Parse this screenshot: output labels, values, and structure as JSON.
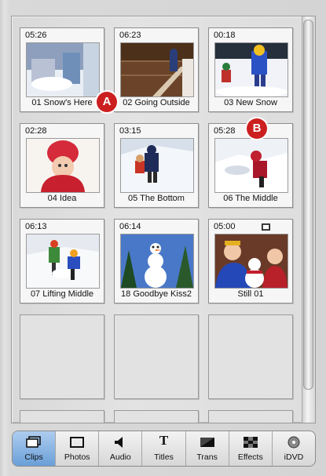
{
  "clips": [
    {
      "duration": "05:26",
      "title": "01 Snow's Here"
    },
    {
      "duration": "06:23",
      "title": "02 Going Outside"
    },
    {
      "duration": "00:18",
      "title": "03 New Snow"
    },
    {
      "duration": "02:28",
      "title": "04 Idea"
    },
    {
      "duration": "03:15",
      "title": "05 The Bottom"
    },
    {
      "duration": "05:28",
      "title": "06 The Middle"
    },
    {
      "duration": "06:13",
      "title": "07 Lifting Middle"
    },
    {
      "duration": "06:14",
      "title": "18 Goodbye Kiss2"
    },
    {
      "duration": "05:00",
      "title": "Still 01",
      "still_icon": "still-frame-icon"
    }
  ],
  "callouts": {
    "a": "A",
    "b": "B"
  },
  "toolbar": {
    "clips": "Clips",
    "photos": "Photos",
    "audio": "Audio",
    "titles": "Titles",
    "trans": "Trans",
    "effects": "Effects",
    "idvd": "iDVD",
    "titles_glyph": "T"
  },
  "colors": {
    "callout": "#cc1f1f",
    "active_tab": "#6a9fd8"
  }
}
